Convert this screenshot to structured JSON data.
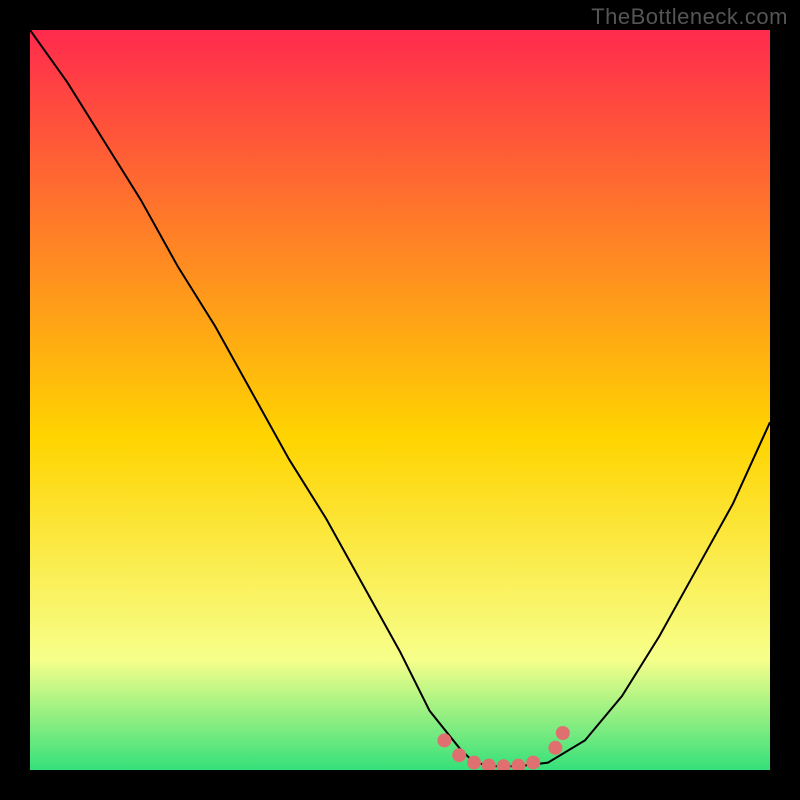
{
  "watermark": "TheBottleneck.com",
  "chart_data": {
    "type": "line",
    "title": "",
    "xlabel": "",
    "ylabel": "",
    "xlim": [
      0,
      100
    ],
    "ylim": [
      0,
      100
    ],
    "background_gradient": {
      "top": "#ff2a4d",
      "mid": "#ffd400",
      "lower": "#f7ff8a",
      "bottom": "#35e07a"
    },
    "series": [
      {
        "name": "bottleneck-curve",
        "color": "#000000",
        "x": [
          0,
          5,
          10,
          15,
          20,
          25,
          30,
          35,
          40,
          45,
          50,
          54,
          58,
          60,
          63,
          66,
          70,
          75,
          80,
          85,
          90,
          95,
          100
        ],
        "y": [
          100,
          93,
          85,
          77,
          68,
          60,
          51,
          42,
          34,
          25,
          16,
          8,
          3,
          1,
          0.5,
          0.5,
          1,
          4,
          10,
          18,
          27,
          36,
          47
        ]
      }
    ],
    "highlight": {
      "name": "optimal-zone-dots",
      "color": "#e07070",
      "x": [
        56,
        58,
        60,
        62,
        64,
        66,
        68,
        71,
        72
      ],
      "y": [
        4,
        2,
        1,
        0.6,
        0.5,
        0.6,
        1,
        3,
        5
      ]
    }
  }
}
